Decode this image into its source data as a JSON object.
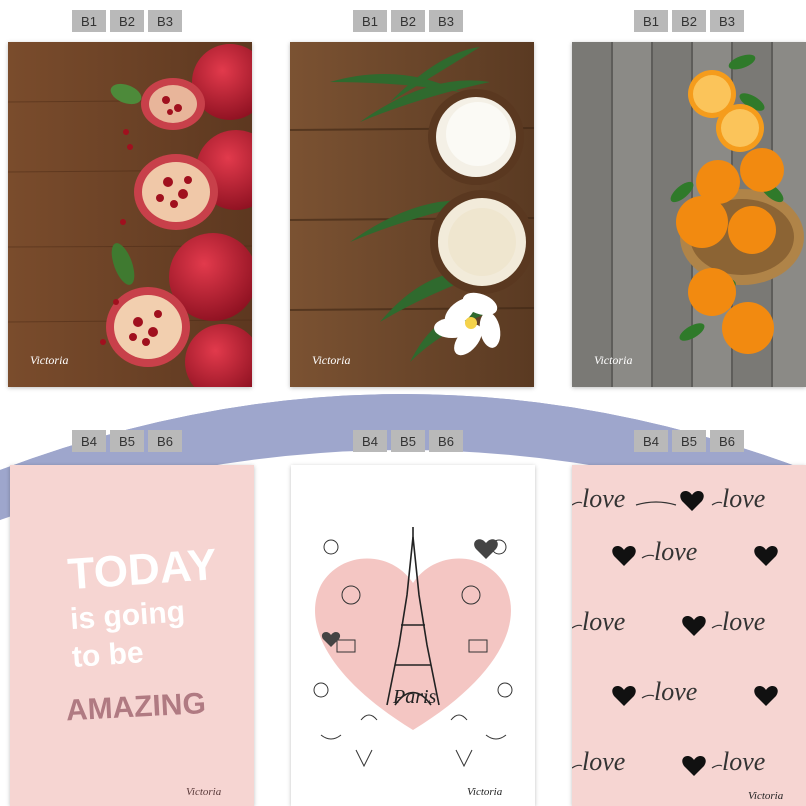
{
  "rows": [
    {
      "tags": [
        "B1",
        "B2",
        "B3"
      ],
      "cards": [
        {
          "name": "pomegranate",
          "brand": "Victoria"
        },
        {
          "name": "coconut",
          "brand": "Victoria"
        },
        {
          "name": "oranges",
          "brand": "Victoria"
        }
      ]
    },
    {
      "tags": [
        "B4",
        "B5",
        "B6"
      ],
      "cards": [
        {
          "name": "today-amazing",
          "brand": "Victoria",
          "lines": [
            "TODAY",
            "is going",
            "to be",
            "AMAZING"
          ]
        },
        {
          "name": "paris",
          "brand": "Victoria",
          "title": "Paris"
        },
        {
          "name": "love",
          "brand": "Victoria",
          "word": "love"
        }
      ]
    }
  ],
  "colors": {
    "arc": "#9ea6cc",
    "tag_bg": "#b9b9b9",
    "pink": "#f6d5d2",
    "wood": "#6b4428"
  }
}
